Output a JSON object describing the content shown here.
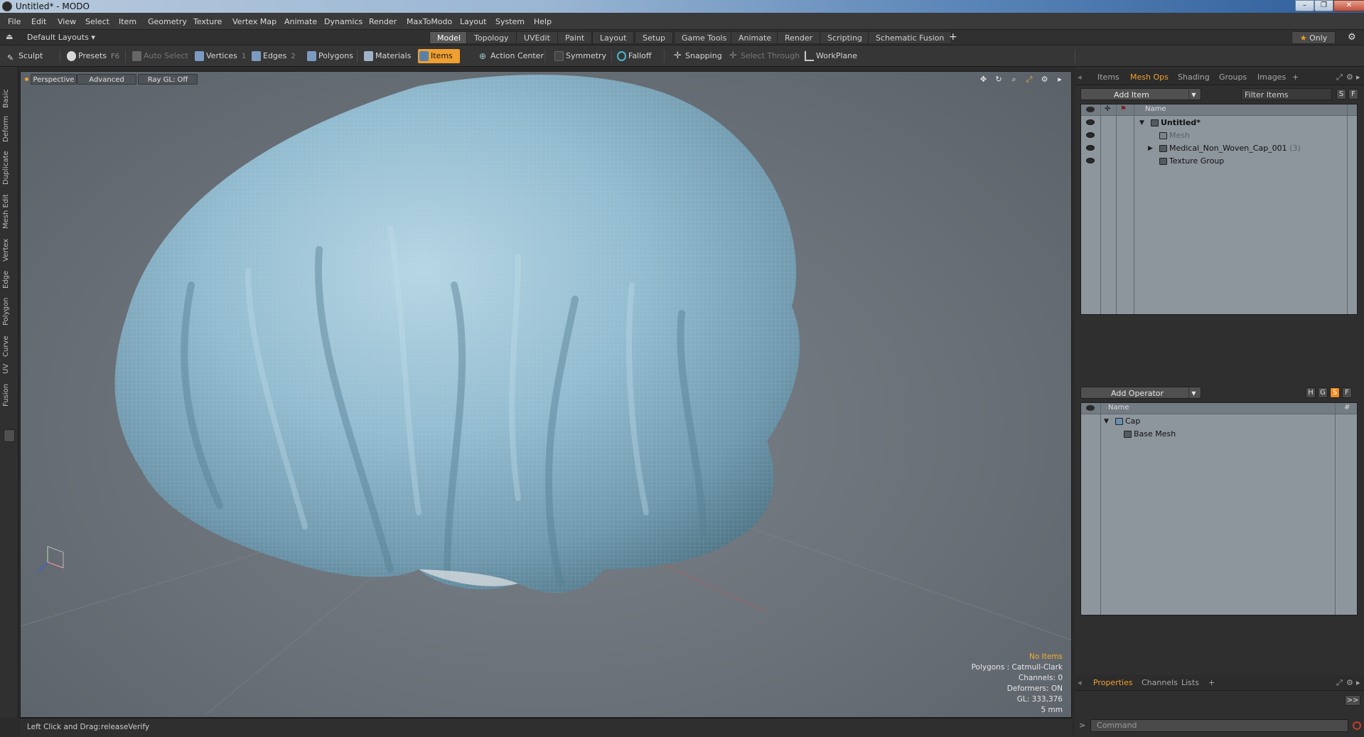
{
  "window": {
    "title": "Untitled* - MODO"
  },
  "menubar": {
    "items": [
      "File",
      "Edit",
      "View",
      "Select",
      "Item",
      "Geometry",
      "Texture",
      "Vertex Map",
      "Animate",
      "Dynamics",
      "Render",
      "MaxToModo",
      "Layout",
      "System",
      "Help"
    ]
  },
  "layouts": {
    "label": "Default Layouts"
  },
  "tabs": [
    "Model",
    "Topology",
    "UVEdit",
    "Paint",
    "Layout",
    "Setup",
    "Game Tools",
    "Animate",
    "Render",
    "Scripting",
    "Schematic Fusion"
  ],
  "tabs_add": "+",
  "only_label": "Only",
  "toolbar": {
    "sculpt": "Sculpt",
    "presets": "Presets",
    "presets_key": "F6",
    "auto_select": "Auto Select",
    "vertices": "Vertices",
    "vertices_key": "1",
    "edges": "Edges",
    "edges_key": "2",
    "polygons": "Polygons",
    "materials": "Materials",
    "items": "Items",
    "action_center": "Action Center",
    "symmetry": "Symmetry",
    "falloff": "Falloff",
    "snapping": "Snapping",
    "select_through": "Select Through",
    "workplane": "WorkPlane"
  },
  "left_tabs": [
    "Basic",
    "Deform",
    "Duplicate",
    "Mesh Edit",
    "Vertex",
    "Edge",
    "Polygon",
    "Curve",
    "UV",
    "Fusion"
  ],
  "viewport": {
    "projection": "Perspective",
    "mode": "Advanced",
    "raygl": "Ray GL: Off",
    "stats": {
      "selection": "No Items",
      "polygons": "Polygons : Catmull-Clark",
      "channels": "Channels: 0",
      "deformers": "Deformers: ON",
      "gl": "GL: 333,376",
      "scale": "5 mm"
    }
  },
  "status": {
    "hint": "Left Click and Drag:",
    "action": "releaseVerify"
  },
  "items_panel": {
    "tabs": [
      "Items",
      "Mesh Ops",
      "Shading",
      "Groups",
      "Images"
    ],
    "active_tab": "Mesh Ops",
    "tabs_add": "+",
    "add_item": "Add Item",
    "filter_placeholder": "Filter Items",
    "s_btn": "S",
    "f_btn": "F",
    "col_name": "Name",
    "rows": [
      {
        "label": "Untitled*"
      },
      {
        "label": "Mesh"
      },
      {
        "label": "Medical_Non_Woven_Cap_001",
        "count": "(3)"
      },
      {
        "label": "Texture Group"
      }
    ]
  },
  "meshops_panel": {
    "add_operator": "Add Operator",
    "btns": [
      "H",
      "G",
      "S",
      "F"
    ],
    "col_name": "Name",
    "col_hash": "#",
    "rows": [
      {
        "label": "Cap"
      },
      {
        "label": "Base Mesh"
      }
    ]
  },
  "properties_panel": {
    "tabs": [
      "Properties",
      "Channels",
      "Lists"
    ],
    "active_tab": "Properties",
    "tabs_add": "+",
    "expand": ">>",
    "command_placeholder": "Command"
  },
  "colors": {
    "accent": "#f0a030",
    "cloth": "#8fb8cc",
    "viewport_bg": "#6a7178"
  }
}
